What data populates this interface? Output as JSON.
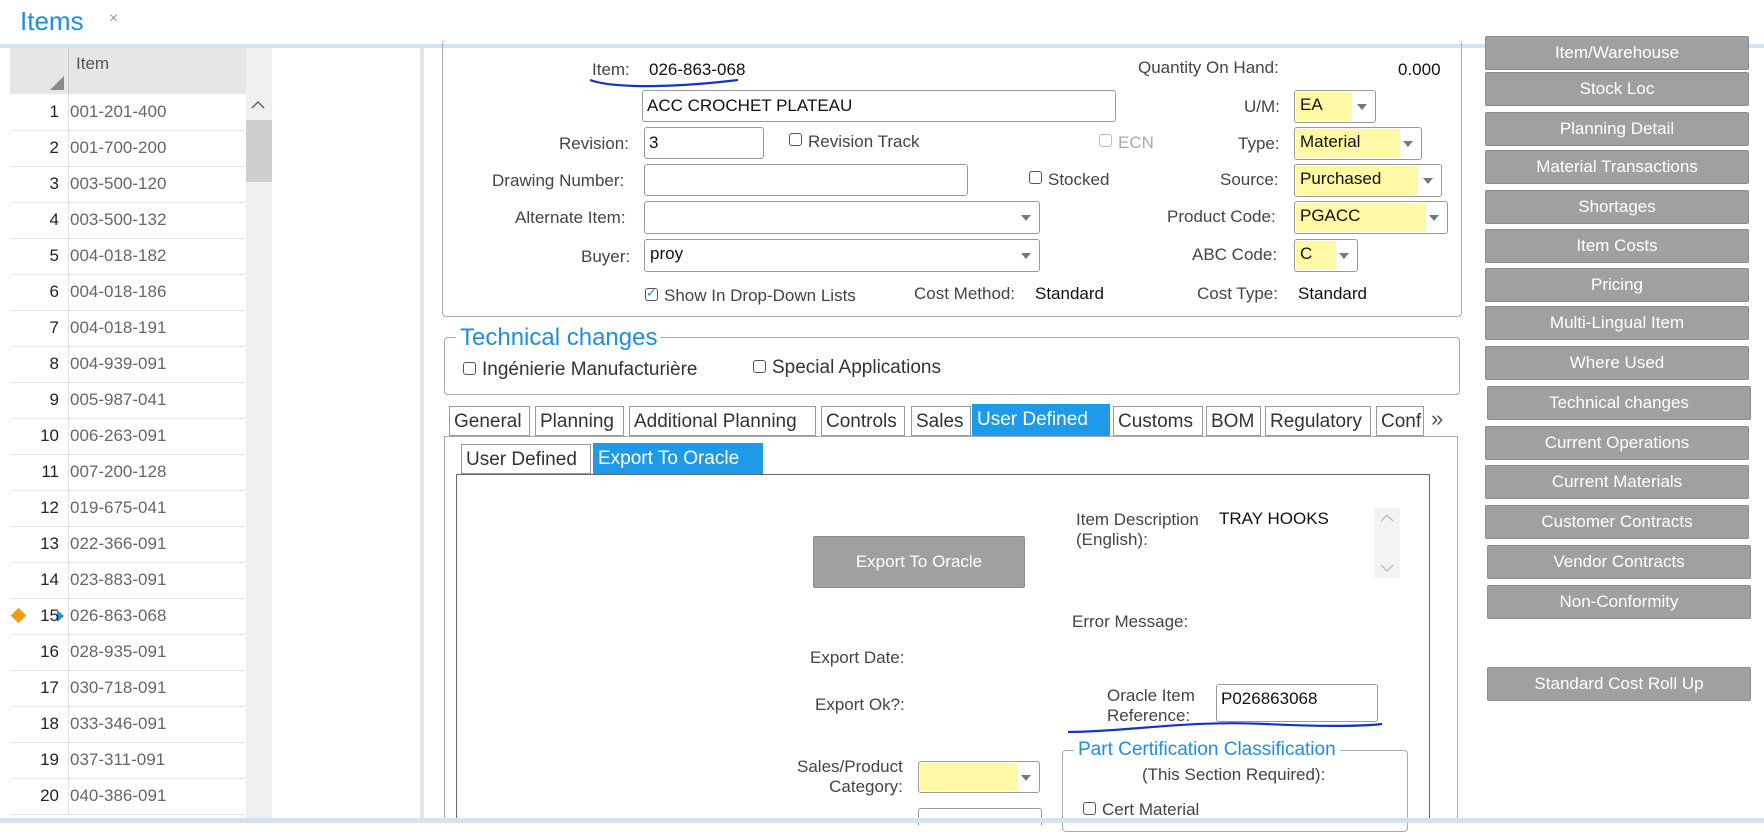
{
  "tab": {
    "title": "Items",
    "close": "×"
  },
  "grid": {
    "header": "Item",
    "rows": [
      {
        "n": "1",
        "code": "001-201-400"
      },
      {
        "n": "2",
        "code": "001-700-200"
      },
      {
        "n": "3",
        "code": "003-500-120"
      },
      {
        "n": "4",
        "code": "003-500-132"
      },
      {
        "n": "5",
        "code": "004-018-182"
      },
      {
        "n": "6",
        "code": "004-018-186"
      },
      {
        "n": "7",
        "code": "004-018-191"
      },
      {
        "n": "8",
        "code": "004-939-091"
      },
      {
        "n": "9",
        "code": "005-987-041"
      },
      {
        "n": "10",
        "code": "006-263-091"
      },
      {
        "n": "11",
        "code": "007-200-128"
      },
      {
        "n": "12",
        "code": "019-675-041"
      },
      {
        "n": "13",
        "code": "022-366-091"
      },
      {
        "n": "14",
        "code": "023-883-091"
      },
      {
        "n": "15",
        "code": "026-863-068"
      },
      {
        "n": "16",
        "code": "028-935-091"
      },
      {
        "n": "17",
        "code": "030-718-091"
      },
      {
        "n": "18",
        "code": "033-346-091"
      },
      {
        "n": "19",
        "code": "037-311-091"
      },
      {
        "n": "20",
        "code": "040-386-091"
      }
    ],
    "selected_index": 14
  },
  "form": {
    "item_label": "Item:",
    "item_value": "026-863-068",
    "description": "ACC CROCHET PLATEAU",
    "revision_label": "Revision:",
    "revision_value": "3",
    "revision_track": "Revision Track",
    "ecn": "ECN",
    "drawing_label": "Drawing Number:",
    "drawing_value": "",
    "stocked": "Stocked",
    "alternate_label": "Alternate Item:",
    "alternate_value": "",
    "buyer_label": "Buyer:",
    "buyer_value": "proy",
    "show_dropdown": "Show In Drop-Down Lists",
    "cost_method_label": "Cost Method:",
    "cost_method_value": "Standard",
    "qoh_label": "Quantity On Hand:",
    "qoh_value": "0.000",
    "um_label": "U/M:",
    "um_value": "EA",
    "type_label": "Type:",
    "type_value": "Material",
    "source_label": "Source:",
    "source_value": "Purchased",
    "product_code_label": "Product Code:",
    "product_code_value": "PGACC",
    "abc_label": "ABC Code:",
    "abc_value": "C",
    "cost_type_label": "Cost Type:",
    "cost_type_value": "Standard"
  },
  "technical": {
    "title": "Technical changes",
    "opt1": "Ingénierie Manufacturière",
    "opt2": "Special Applications"
  },
  "tabs": [
    "General",
    "Planning",
    "Additional Planning",
    "Controls",
    "Sales",
    "User Defined",
    "Customs",
    "BOM",
    "Regulatory",
    "Conf"
  ],
  "tabs_more": "»",
  "subtabs": [
    "User Defined",
    "Export To Oracle"
  ],
  "export": {
    "button": "Export To Oracle",
    "desc_label": "Item Description\n(English):",
    "desc_value": "TRAY HOOKS",
    "error_label": "Error Message:",
    "export_date_label": "Export Date:",
    "export_ok_label": "Export Ok?:",
    "oracle_ref_label": "Oracle Item\nReference:",
    "oracle_ref_value": "P026863068",
    "sales_cat_label": "Sales/Product\nCategory:",
    "part_cert_title": "Part Certification Classification",
    "part_cert_sub": "(This Section Required):",
    "cert_material": "Cert Material"
  },
  "side_buttons": [
    "Item/Warehouse",
    "Stock Loc",
    "Planning Detail",
    "Material Transactions",
    "Shortages",
    "Item Costs",
    "Pricing",
    "Multi-Lingual Item",
    "Where Used",
    "Technical changes",
    "Current Operations",
    "Current Materials",
    "Customer Contracts",
    "Vendor Contracts",
    "Non-Conformity",
    "Standard Cost Roll Up"
  ],
  "colors": {
    "accent": "#1e9be8",
    "required": "#fff9a6",
    "button": "#a0a0a0"
  }
}
